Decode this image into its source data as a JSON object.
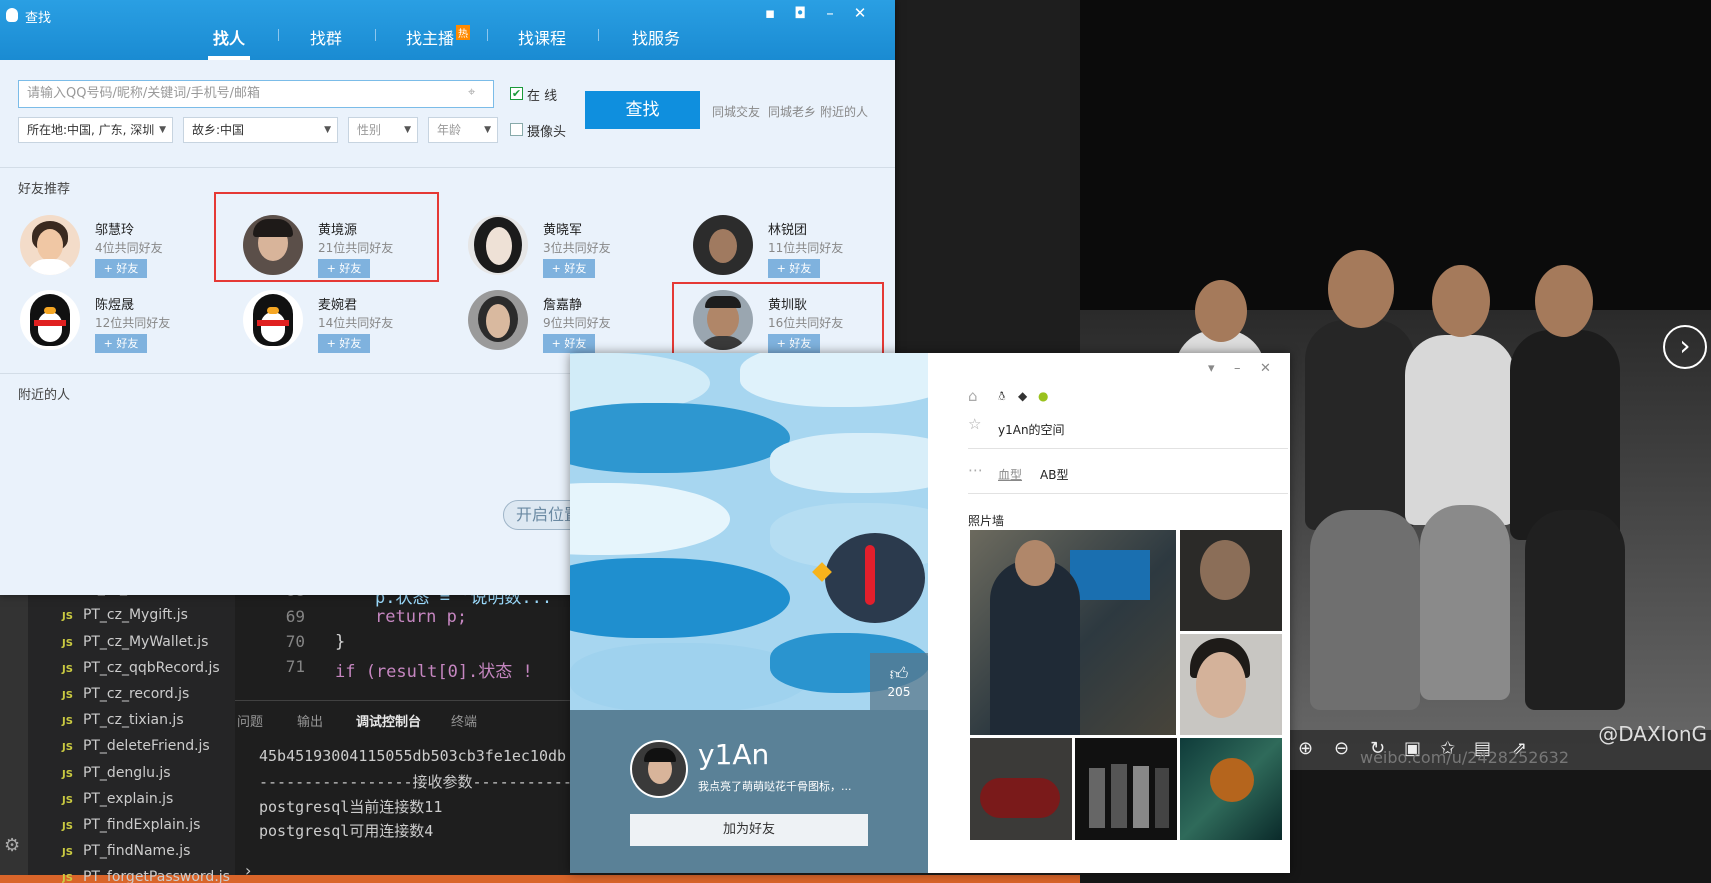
{
  "vscode": {
    "files": [
      "PT_cz_Mygift.js",
      "PT_cz_MyWallet.js",
      "PT_cz_qqbRecord.js",
      "PT_cz_record.js",
      "PT_cz_tixian.js",
      "PT_deleteFriend.js",
      "PT_denglu.js",
      "PT_explain.js",
      "PT_findExplain.js",
      "PT_findName.js",
      "PT_forgetPassword.js"
    ],
    "line_numbers": [
      "69",
      "70",
      "71"
    ],
    "code": {
      "line69": "return p;",
      "line70": "}",
      "line71_prefix": "if (result[0].状态 !"
    },
    "panel_tabs": [
      "问题",
      "输出",
      "调试控制台",
      "终端"
    ],
    "terminal": {
      "line1": "45b45193004115055db503cb3fe1ec10db",
      "line2": "-----------------接收参数-----------",
      "line3": "postgresql当前连接数11",
      "line4": "postgresql可用连接数4"
    },
    "prompt": "›"
  },
  "find_window": {
    "title": "查找",
    "tabs": [
      "找人",
      "找群",
      "找主播",
      "找课程",
      "找服务"
    ],
    "hot_badge": "热",
    "search": {
      "placeholder": "请输入QQ号码/昵称/关键词/手机号/邮箱",
      "button": "查找"
    },
    "online_label": "在 线",
    "camera_label": "摄像头",
    "side_links": [
      "同城交友",
      "同城老乡",
      "附近的人"
    ],
    "filters": {
      "location": "所在地:中国, 广东, 深圳",
      "hometown": "故乡:中国",
      "gender": "性别",
      "age": "年龄"
    },
    "recommend_title": "好友推荐",
    "add_label": "+ 好友",
    "friends": [
      {
        "name": "邬慧玲",
        "mutual": "4位共同好友"
      },
      {
        "name": "黄境源",
        "mutual": "21位共同好友"
      },
      {
        "name": "黄晓军",
        "mutual": "3位共同好友"
      },
      {
        "name": "林锐团",
        "mutual": "11位共同好友"
      },
      {
        "name": "陈煜晟",
        "mutual": "12位共同好友"
      },
      {
        "name": "麦婉君",
        "mutual": "14位共同好友"
      },
      {
        "name": "詹嘉静",
        "mutual": "9位共同好友"
      },
      {
        "name": "黄圳耿",
        "mutual": "16位共同好友"
      }
    ],
    "nearby_title": "附近的人",
    "enable_location": "开启位置"
  },
  "profile_card": {
    "likes": "205",
    "nickname": "y1An",
    "signature": "我点亮了萌萌哒花千骨图标，...",
    "add_friend": "加为好友",
    "space": "y1An的空间",
    "blood_type_key": "血型",
    "blood_type_value": "AB型",
    "photo_wall_title": "照片墙"
  },
  "photo_viewer": {
    "watermark": "@DAXIonG",
    "url": "weibo.com/u/2428252632"
  },
  "colors": {
    "qq_blue": "#1a8bd2",
    "highlight_red": "#e53935",
    "search_button": "#0f8fde"
  }
}
